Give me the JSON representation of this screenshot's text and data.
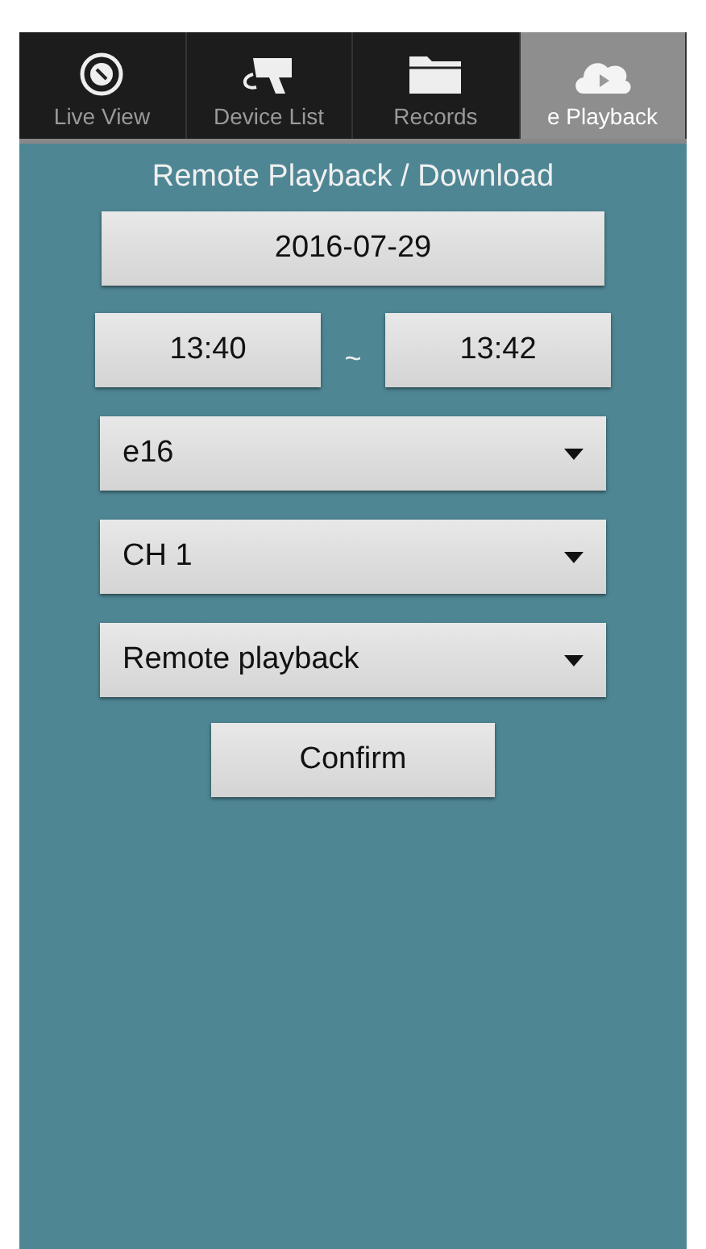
{
  "tabs": [
    {
      "label": "Live View",
      "kind": "target",
      "selected": false
    },
    {
      "label": "Device List",
      "kind": "camera",
      "selected": false
    },
    {
      "label": "Records",
      "kind": "folder",
      "selected": false
    },
    {
      "label": "e Playback",
      "kind": "cloud",
      "selected": true
    }
  ],
  "title": "Remote Playback / Download",
  "date": "2016-07-29",
  "time_from": "13:40",
  "separator": "~",
  "time_to": "13:42",
  "dropdowns": [
    {
      "value": "e16"
    },
    {
      "value": "CH 1"
    },
    {
      "value": "Remote playback"
    }
  ],
  "confirm": "Confirm"
}
